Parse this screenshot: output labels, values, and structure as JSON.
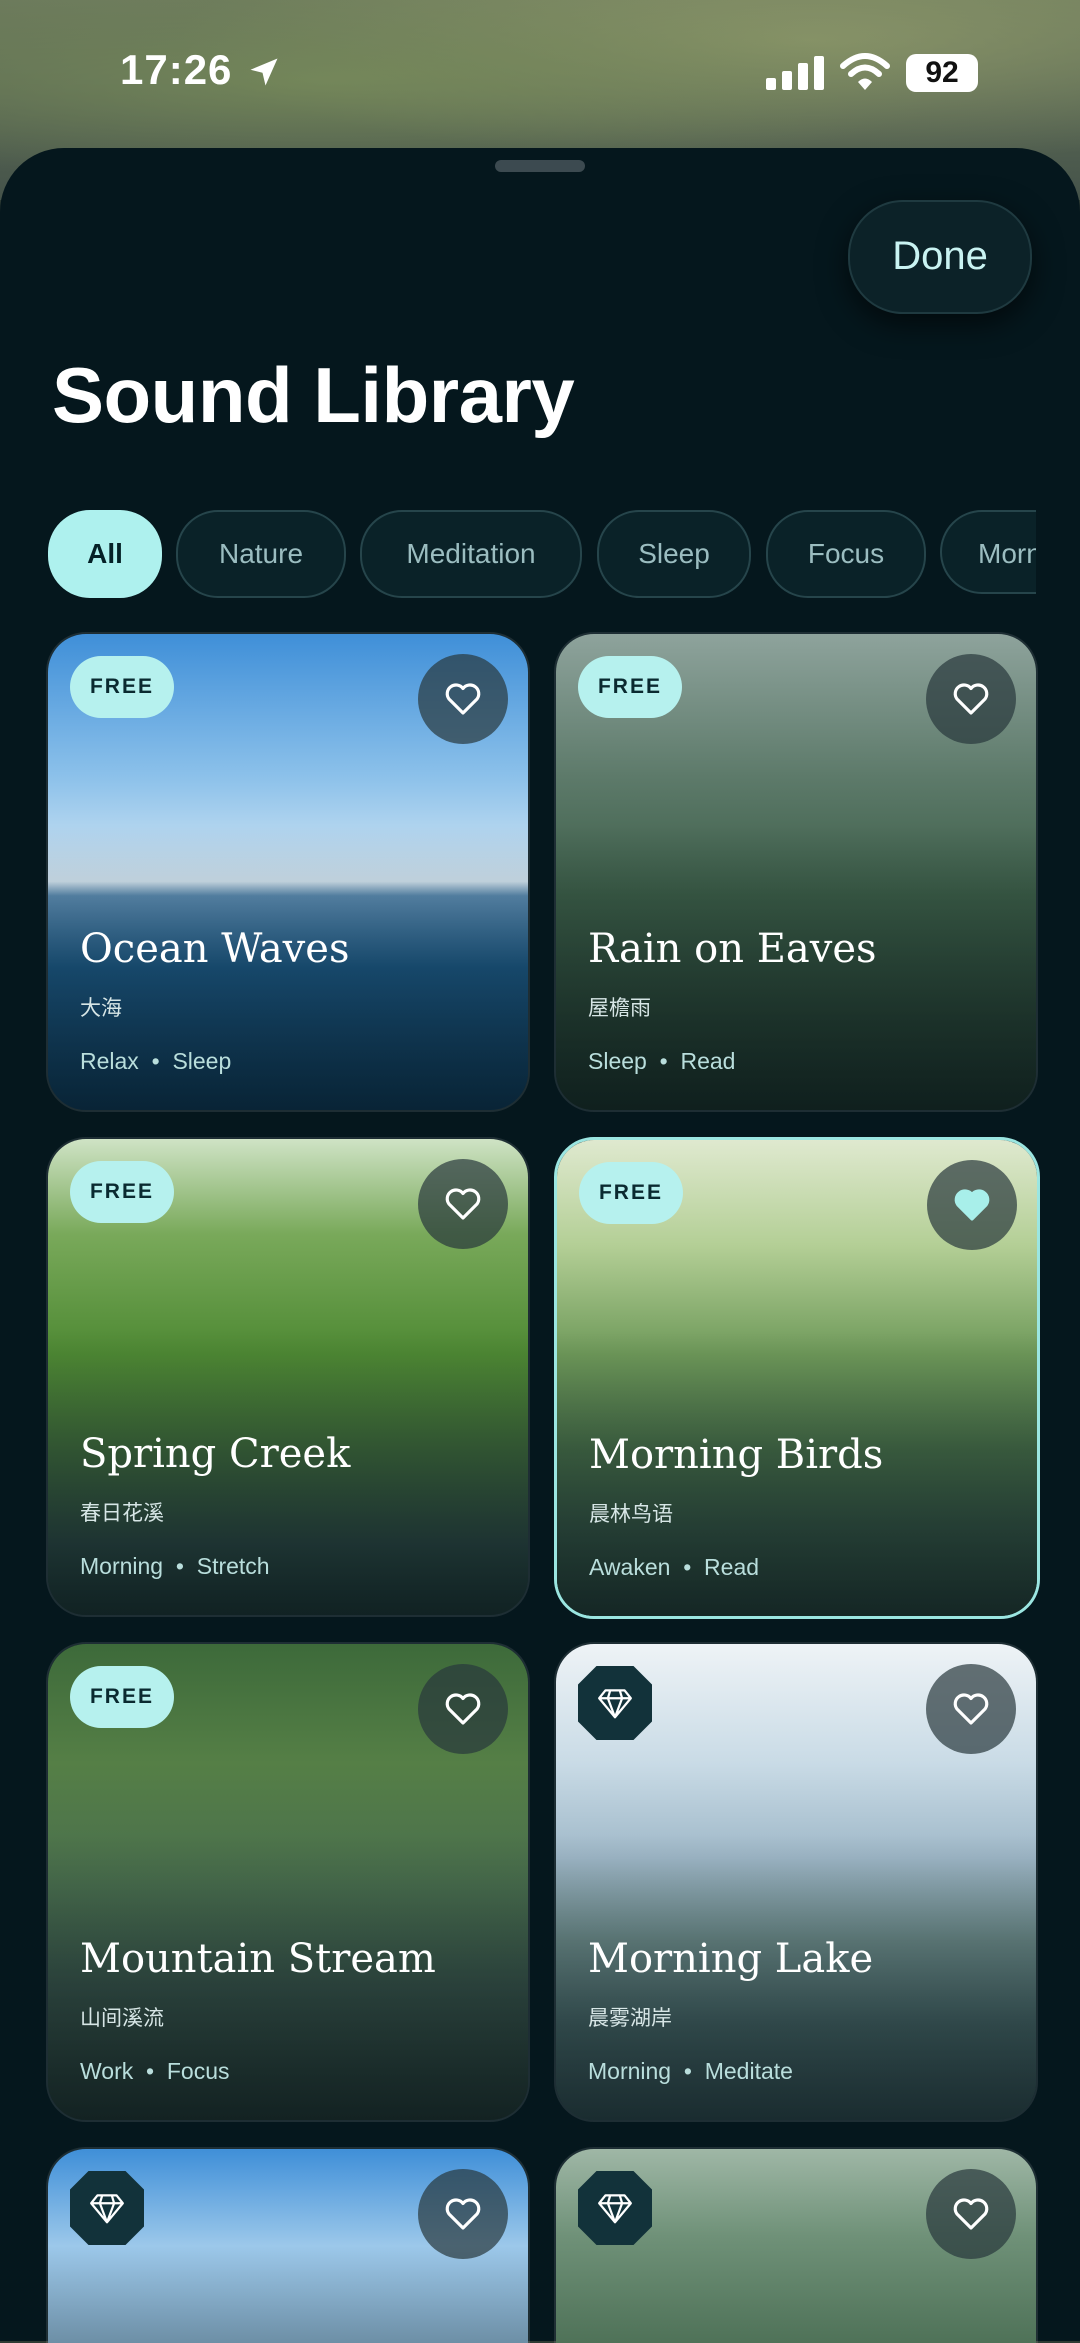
{
  "status": {
    "time": "17:26",
    "battery": "92"
  },
  "header": {
    "done_label": "Done",
    "title": "Sound Library"
  },
  "filters": [
    "All",
    "Nature",
    "Meditation",
    "Sleep",
    "Focus",
    "Morning"
  ],
  "cards": [
    {
      "badge": "FREE",
      "title": "Ocean Waves",
      "subtitle": "大海",
      "tag1": "Relax",
      "tag2": "Sleep"
    },
    {
      "badge": "FREE",
      "title": "Rain on Eaves",
      "subtitle": "屋檐雨",
      "tag1": "Sleep",
      "tag2": "Read"
    },
    {
      "badge": "FREE",
      "title": "Spring Creek",
      "subtitle": "春日花溪",
      "tag1": "Morning",
      "tag2": "Stretch"
    },
    {
      "badge": "FREE",
      "title": "Morning Birds",
      "subtitle": "晨林鸟语",
      "tag1": "Awaken",
      "tag2": "Read"
    },
    {
      "badge": "FREE",
      "title": "Mountain Stream",
      "subtitle": "山间溪流",
      "tag1": "Work",
      "tag2": "Focus"
    },
    {
      "badge": "premium",
      "title": "Morning Lake",
      "subtitle": "晨雾湖岸",
      "tag1": "Morning",
      "tag2": "Meditate"
    }
  ]
}
